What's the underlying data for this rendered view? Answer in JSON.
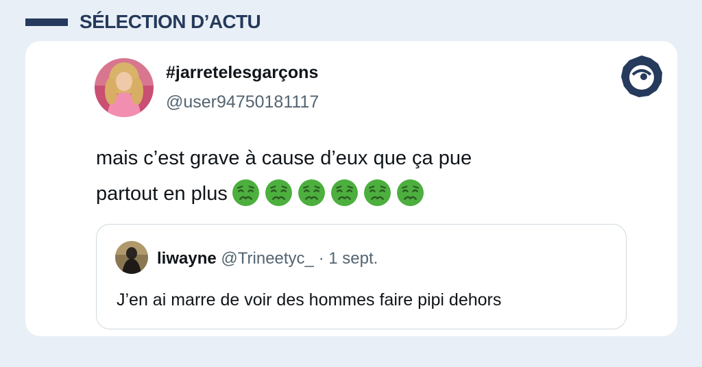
{
  "header": {
    "title": "SÉLECTION D’ACTU"
  },
  "tweet": {
    "display_name": "#jarretelesgarçons",
    "handle": "@user94750181117",
    "text_line1": "mais c’est grave à cause d’eux que ça pue",
    "text_line2": "partout en plus",
    "emoji_name": "nauseated-face",
    "emoji_count": 6
  },
  "quote": {
    "name": "liwayne",
    "handle": "@Trineetyc_",
    "separator": " · ",
    "date": "1 sept.",
    "text": "J’en ai marre de voir des hommes faire pipi dehors"
  },
  "colors": {
    "background": "#e9eff6",
    "brand_navy": "#253a5c",
    "emoji_green": "#4caf3e"
  }
}
